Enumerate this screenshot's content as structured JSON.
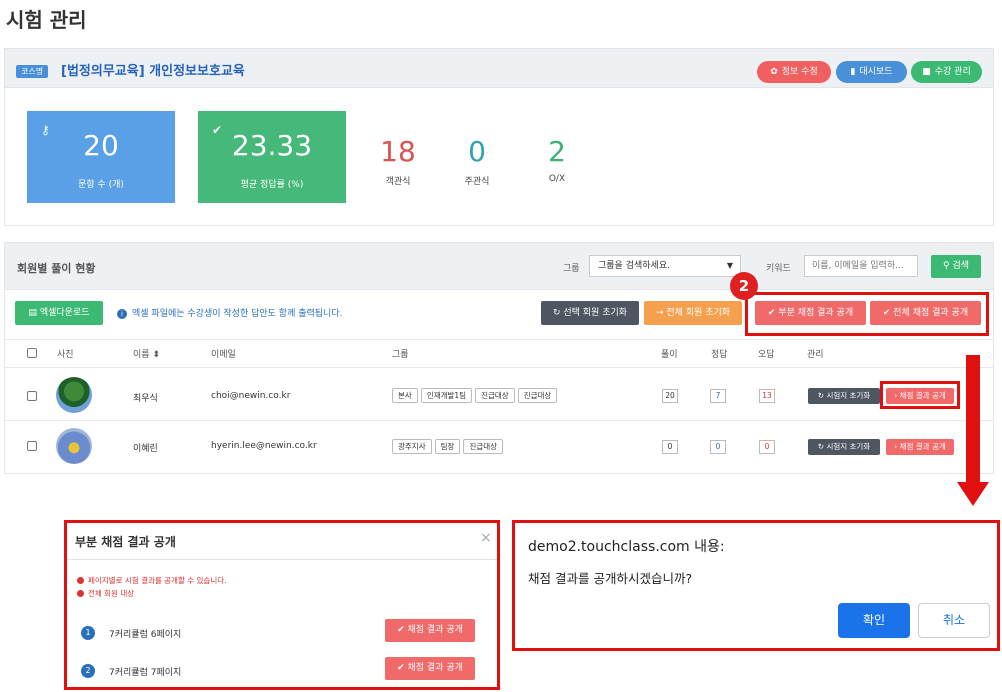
{
  "page": {
    "title": "시험 관리"
  },
  "course": {
    "badge": "코스명",
    "title": "[법정의무교육] 개인정보보호교육",
    "buttons": {
      "edit": "정보 수정",
      "dashboard": "대시보드",
      "manage": "수강 관리"
    },
    "stats": {
      "questions_value": "20",
      "questions_label": "문항 수 (개)",
      "score_value": "23.33",
      "score_label": "평균 정답률 (%)"
    },
    "counts": [
      {
        "value": "18",
        "label": "객관식",
        "color": "#d9534f"
      },
      {
        "value": "0",
        "label": "주관식",
        "color": "#2fa3b0"
      },
      {
        "value": "2",
        "label": "O/X",
        "color": "#3cb371"
      }
    ]
  },
  "members": {
    "title": "회원별 풀이 현황",
    "group_label": "그룹",
    "group_select": "그룹을 검색하세요.",
    "keyword_label": "키워드",
    "keyword_placeholder": "이름, 이메일을 입력하...",
    "search": "검색",
    "excel_button": "엑셀다운로드",
    "excel_note": "엑셀 파일에는 수강생이 작성한 답안도 함께 출력됩니다.",
    "reset_selected": "선택 회원 초기화",
    "reset_all": "전체 회원 초기화",
    "partial_publish": "부분 채점 결과 공개",
    "full_publish": "전체 채점 결과 공개",
    "callout_number": "2",
    "columns": {
      "photo": "사진",
      "name": "이름",
      "email": "이메일",
      "group": "그룹",
      "solved": "풀이",
      "correct": "정답",
      "wrong": "오답",
      "manage": "관리"
    },
    "rows": [
      {
        "name": "최우식",
        "email": "choi@newin.co.kr",
        "tags": [
          "본사",
          "인재개발1팀",
          "진급대상",
          "진급대상"
        ],
        "solved": "20",
        "correct": "7",
        "wrong": "13",
        "reset": "시험지 초기화",
        "publish": "채점 결과 공개"
      },
      {
        "name": "이혜린",
        "email": "hyerin.lee@newin.co.kr",
        "tags": [
          "광주지사",
          "팀장",
          "진급대상"
        ],
        "solved": "0",
        "correct": "0",
        "wrong": "0",
        "reset": "시험지 초기화",
        "publish": "채점 결과 공개"
      }
    ]
  },
  "modal": {
    "title": "부분 채점 결과 공개",
    "close": "×",
    "notes": [
      "페이지별로 시험 결과를 공개할 수 있습니다.",
      "전체 회원 대상"
    ],
    "pages": [
      {
        "num": "1",
        "label": "7커리큘럼 6페이지",
        "button": "채점 결과 공개"
      },
      {
        "num": "2",
        "label": "7커리큘럼 7페이지",
        "button": "채점 결과 공개"
      }
    ]
  },
  "confirm": {
    "origin": "demo2.touchclass.com 내용:",
    "message": "채점 결과를 공개하시겠습니까?",
    "ok": "확인",
    "cancel": "취소"
  },
  "icons": {
    "edit": "gear-icon",
    "dashboard": "bar-chart-icon",
    "manage": "briefcase-icon",
    "questions": "key-icon",
    "score": "check-circle-icon",
    "search": "search-icon",
    "excel": "file-excel-icon",
    "reset": "refresh-icon",
    "publish": "check-circle-icon"
  }
}
